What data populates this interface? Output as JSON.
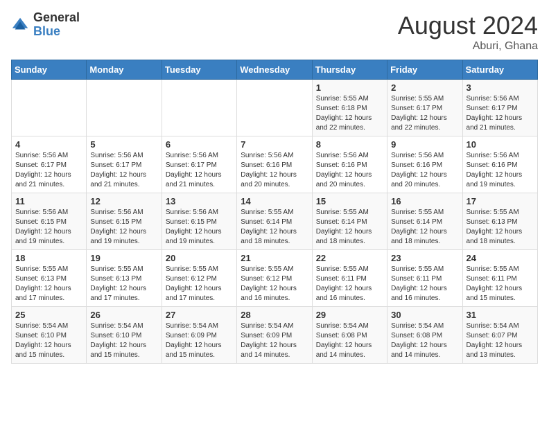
{
  "header": {
    "logo_general": "General",
    "logo_blue": "Blue",
    "month_year": "August 2024",
    "location": "Aburi, Ghana"
  },
  "days_of_week": [
    "Sunday",
    "Monday",
    "Tuesday",
    "Wednesday",
    "Thursday",
    "Friday",
    "Saturday"
  ],
  "weeks": [
    [
      {
        "day": "",
        "info": ""
      },
      {
        "day": "",
        "info": ""
      },
      {
        "day": "",
        "info": ""
      },
      {
        "day": "",
        "info": ""
      },
      {
        "day": "1",
        "info": "Sunrise: 5:55 AM\nSunset: 6:18 PM\nDaylight: 12 hours\nand 22 minutes."
      },
      {
        "day": "2",
        "info": "Sunrise: 5:55 AM\nSunset: 6:17 PM\nDaylight: 12 hours\nand 22 minutes."
      },
      {
        "day": "3",
        "info": "Sunrise: 5:56 AM\nSunset: 6:17 PM\nDaylight: 12 hours\nand 21 minutes."
      }
    ],
    [
      {
        "day": "4",
        "info": "Sunrise: 5:56 AM\nSunset: 6:17 PM\nDaylight: 12 hours\nand 21 minutes."
      },
      {
        "day": "5",
        "info": "Sunrise: 5:56 AM\nSunset: 6:17 PM\nDaylight: 12 hours\nand 21 minutes."
      },
      {
        "day": "6",
        "info": "Sunrise: 5:56 AM\nSunset: 6:17 PM\nDaylight: 12 hours\nand 21 minutes."
      },
      {
        "day": "7",
        "info": "Sunrise: 5:56 AM\nSunset: 6:16 PM\nDaylight: 12 hours\nand 20 minutes."
      },
      {
        "day": "8",
        "info": "Sunrise: 5:56 AM\nSunset: 6:16 PM\nDaylight: 12 hours\nand 20 minutes."
      },
      {
        "day": "9",
        "info": "Sunrise: 5:56 AM\nSunset: 6:16 PM\nDaylight: 12 hours\nand 20 minutes."
      },
      {
        "day": "10",
        "info": "Sunrise: 5:56 AM\nSunset: 6:16 PM\nDaylight: 12 hours\nand 19 minutes."
      }
    ],
    [
      {
        "day": "11",
        "info": "Sunrise: 5:56 AM\nSunset: 6:15 PM\nDaylight: 12 hours\nand 19 minutes."
      },
      {
        "day": "12",
        "info": "Sunrise: 5:56 AM\nSunset: 6:15 PM\nDaylight: 12 hours\nand 19 minutes."
      },
      {
        "day": "13",
        "info": "Sunrise: 5:56 AM\nSunset: 6:15 PM\nDaylight: 12 hours\nand 19 minutes."
      },
      {
        "day": "14",
        "info": "Sunrise: 5:55 AM\nSunset: 6:14 PM\nDaylight: 12 hours\nand 18 minutes."
      },
      {
        "day": "15",
        "info": "Sunrise: 5:55 AM\nSunset: 6:14 PM\nDaylight: 12 hours\nand 18 minutes."
      },
      {
        "day": "16",
        "info": "Sunrise: 5:55 AM\nSunset: 6:14 PM\nDaylight: 12 hours\nand 18 minutes."
      },
      {
        "day": "17",
        "info": "Sunrise: 5:55 AM\nSunset: 6:13 PM\nDaylight: 12 hours\nand 18 minutes."
      }
    ],
    [
      {
        "day": "18",
        "info": "Sunrise: 5:55 AM\nSunset: 6:13 PM\nDaylight: 12 hours\nand 17 minutes."
      },
      {
        "day": "19",
        "info": "Sunrise: 5:55 AM\nSunset: 6:13 PM\nDaylight: 12 hours\nand 17 minutes."
      },
      {
        "day": "20",
        "info": "Sunrise: 5:55 AM\nSunset: 6:12 PM\nDaylight: 12 hours\nand 17 minutes."
      },
      {
        "day": "21",
        "info": "Sunrise: 5:55 AM\nSunset: 6:12 PM\nDaylight: 12 hours\nand 16 minutes."
      },
      {
        "day": "22",
        "info": "Sunrise: 5:55 AM\nSunset: 6:11 PM\nDaylight: 12 hours\nand 16 minutes."
      },
      {
        "day": "23",
        "info": "Sunrise: 5:55 AM\nSunset: 6:11 PM\nDaylight: 12 hours\nand 16 minutes."
      },
      {
        "day": "24",
        "info": "Sunrise: 5:55 AM\nSunset: 6:11 PM\nDaylight: 12 hours\nand 15 minutes."
      }
    ],
    [
      {
        "day": "25",
        "info": "Sunrise: 5:54 AM\nSunset: 6:10 PM\nDaylight: 12 hours\nand 15 minutes."
      },
      {
        "day": "26",
        "info": "Sunrise: 5:54 AM\nSunset: 6:10 PM\nDaylight: 12 hours\nand 15 minutes."
      },
      {
        "day": "27",
        "info": "Sunrise: 5:54 AM\nSunset: 6:09 PM\nDaylight: 12 hours\nand 15 minutes."
      },
      {
        "day": "28",
        "info": "Sunrise: 5:54 AM\nSunset: 6:09 PM\nDaylight: 12 hours\nand 14 minutes."
      },
      {
        "day": "29",
        "info": "Sunrise: 5:54 AM\nSunset: 6:08 PM\nDaylight: 12 hours\nand 14 minutes."
      },
      {
        "day": "30",
        "info": "Sunrise: 5:54 AM\nSunset: 6:08 PM\nDaylight: 12 hours\nand 14 minutes."
      },
      {
        "day": "31",
        "info": "Sunrise: 5:54 AM\nSunset: 6:07 PM\nDaylight: 12 hours\nand 13 minutes."
      }
    ]
  ]
}
